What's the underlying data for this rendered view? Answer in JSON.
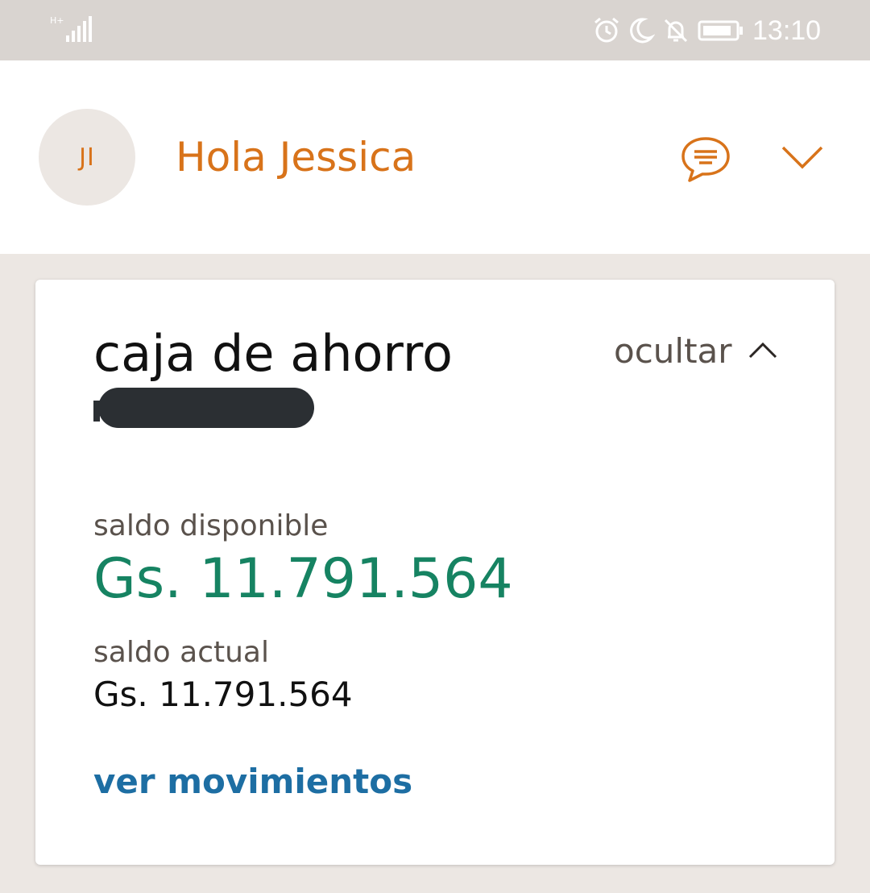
{
  "status_bar": {
    "network": "H+",
    "time": "13:10",
    "icons": [
      "signal-icon",
      "alarm-icon",
      "moon-icon",
      "notifications-off-icon",
      "battery-icon"
    ]
  },
  "header": {
    "avatar_initials": "JI",
    "greeting": "Hola Jessica",
    "icons": [
      "chat-icon",
      "chevron-down-icon"
    ],
    "accent_color": "#d8731a"
  },
  "account_card": {
    "type": "caja de ahorro",
    "hide_label": "ocultar",
    "available_label": "saldo disponible",
    "available_amount": "Gs. 11.791.564",
    "current_label": "saldo actual",
    "current_amount": "Gs. 11.791.564",
    "movements_link": "ver movimientos",
    "colors": {
      "available_amount": "#168362",
      "link": "#1d6ea3"
    }
  }
}
